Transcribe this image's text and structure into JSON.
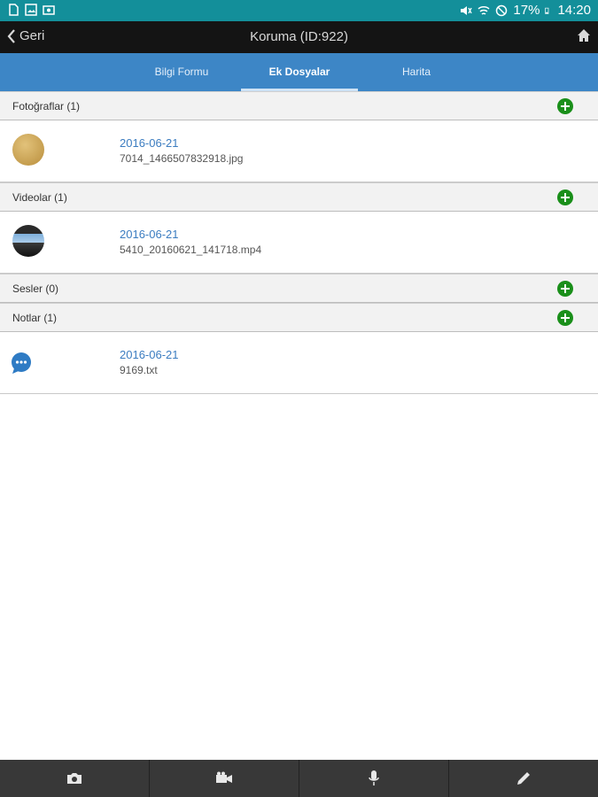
{
  "status_bar": {
    "battery": "17%",
    "time": "14:20",
    "left_icons": [
      "sim-icon",
      "image-icon",
      "camera-notification-icon"
    ],
    "right_icons": [
      "mute-icon",
      "wifi-icon",
      "block-icon",
      "battery-icon"
    ]
  },
  "navbar": {
    "back_label": "Geri",
    "title": "Koruma (ID:922)",
    "home_icon": "home-icon"
  },
  "tabs": [
    {
      "label": "Bilgi Formu",
      "active": false
    },
    {
      "label": "Ek Dosyalar",
      "active": true
    },
    {
      "label": "Harita",
      "active": false
    }
  ],
  "sections": {
    "photos": {
      "label": "Fotoğraflar (1)",
      "items": [
        {
          "date": "2016-06-21",
          "filename": "7014_1466507832918.jpg"
        }
      ]
    },
    "videos": {
      "label": "Videolar (1)",
      "items": [
        {
          "date": "2016-06-21",
          "filename": "5410_20160621_141718.mp4"
        }
      ]
    },
    "sounds": {
      "label": "Sesler (0)",
      "items": []
    },
    "notes": {
      "label": "Notlar (1)",
      "items": [
        {
          "date": "2016-06-21",
          "filename": "9169.txt"
        }
      ]
    }
  },
  "bottom_bar": [
    "camera-icon",
    "video-camera-icon",
    "microphone-icon",
    "pencil-icon"
  ],
  "colors": {
    "status_bar": "#138f9a",
    "nav_bar": "#141414",
    "tab_bar": "#3d86c6",
    "link": "#3b7cc0",
    "add_button": "#1a8f1a",
    "bottom_bar": "#383838"
  }
}
